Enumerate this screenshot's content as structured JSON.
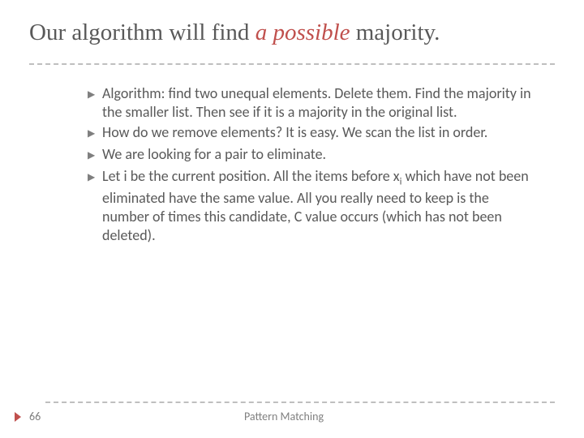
{
  "title": {
    "pre": "Our algorithm will find ",
    "em": "a possible",
    "post": " majority."
  },
  "bullets": [
    "Algorithm: find two unequal elements.  Delete them.  Find the majority in the smaller list.  Then see if it is a majority in the original list.",
    "How do we remove elements?  It is easy.  We scan the list in order.",
    "We are looking for a pair to eliminate.",
    "Let i be the current position.  All the items before x<span class=\"sub\">i</span> which have not been eliminated have the same value.  All you really need to keep is the number of times this  candidate, C value occurs (which has not been deleted)."
  ],
  "slide_number": "66",
  "footer_text": "Pattern Matching"
}
